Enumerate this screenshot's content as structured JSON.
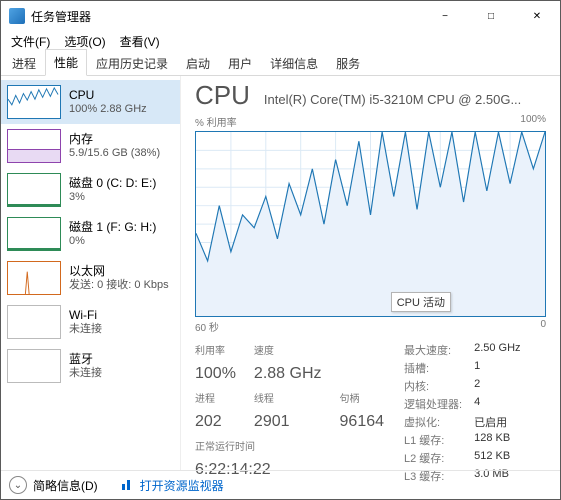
{
  "window": {
    "title": "任务管理器"
  },
  "menu": {
    "file": "文件(F)",
    "options": "选项(O)",
    "view": "查看(V)"
  },
  "tabs": {
    "processes": "进程",
    "performance": "性能",
    "app_history": "应用历史记录",
    "startup": "启动",
    "users": "用户",
    "details": "详细信息",
    "services": "服务"
  },
  "sidebar": {
    "items": [
      {
        "name": "CPU",
        "sub": "100% 2.88 GHz"
      },
      {
        "name": "内存",
        "sub": "5.9/15.6 GB (38%)"
      },
      {
        "name": "磁盘 0 (C: D: E:)",
        "sub": "3%"
      },
      {
        "name": "磁盘 1 (F: G: H:)",
        "sub": "0%"
      },
      {
        "name": "以太网",
        "sub": "发送: 0 接收: 0 Kbps"
      },
      {
        "name": "Wi-Fi",
        "sub": "未连接"
      },
      {
        "name": "蓝牙",
        "sub": "未连接"
      }
    ]
  },
  "main": {
    "cpu_title": "CPU",
    "cpu_model": "Intel(R) Core(TM) i5-3210M CPU @ 2.50G...",
    "y_axis_label_left": "% 利用率",
    "y_axis_label_right": "100%",
    "x_axis_label_left": "60 秒",
    "x_axis_label_right": "0",
    "chart_tooltip": "CPU 活动",
    "stats": {
      "util_label": "利用率",
      "util_value": "100%",
      "speed_label": "速度",
      "speed_value": "2.88 GHz",
      "proc_label": "进程",
      "proc_value": "202",
      "thread_label": "线程",
      "thread_value": "2901",
      "handle_label": "句柄",
      "handle_value": "96164",
      "uptime_label": "正常运行时间",
      "uptime_value": "6:22:14:22"
    },
    "props": {
      "max_speed_k": "最大速度:",
      "max_speed_v": "2.50 GHz",
      "sockets_k": "插槽:",
      "sockets_v": "1",
      "cores_k": "内核:",
      "cores_v": "2",
      "lprocs_k": "逻辑处理器:",
      "lprocs_v": "4",
      "virt_k": "虚拟化:",
      "virt_v": "已启用",
      "l1_k": "L1 缓存:",
      "l1_v": "128 KB",
      "l2_k": "L2 缓存:",
      "l2_v": "512 KB",
      "l3_k": "L3 缓存:",
      "l3_v": "3.0 MB"
    }
  },
  "footer": {
    "brief": "简略信息(D)",
    "open_resmon": "打开资源监视器"
  },
  "chart_data": {
    "type": "line",
    "title": "CPU 活动",
    "xlabel": "60 秒 → 0",
    "ylabel": "% 利用率",
    "ylim": [
      0,
      100
    ],
    "x_seconds_ago": [
      60,
      58,
      56,
      54,
      52,
      50,
      48,
      46,
      44,
      42,
      40,
      38,
      36,
      34,
      32,
      30,
      28,
      26,
      24,
      22,
      20,
      18,
      16,
      14,
      12,
      10,
      8,
      6,
      4,
      2,
      0
    ],
    "values": [
      45,
      30,
      60,
      35,
      55,
      48,
      65,
      42,
      72,
      55,
      80,
      50,
      85,
      60,
      95,
      55,
      100,
      65,
      100,
      58,
      100,
      70,
      100,
      62,
      100,
      68,
      100,
      72,
      100,
      80,
      100
    ]
  }
}
